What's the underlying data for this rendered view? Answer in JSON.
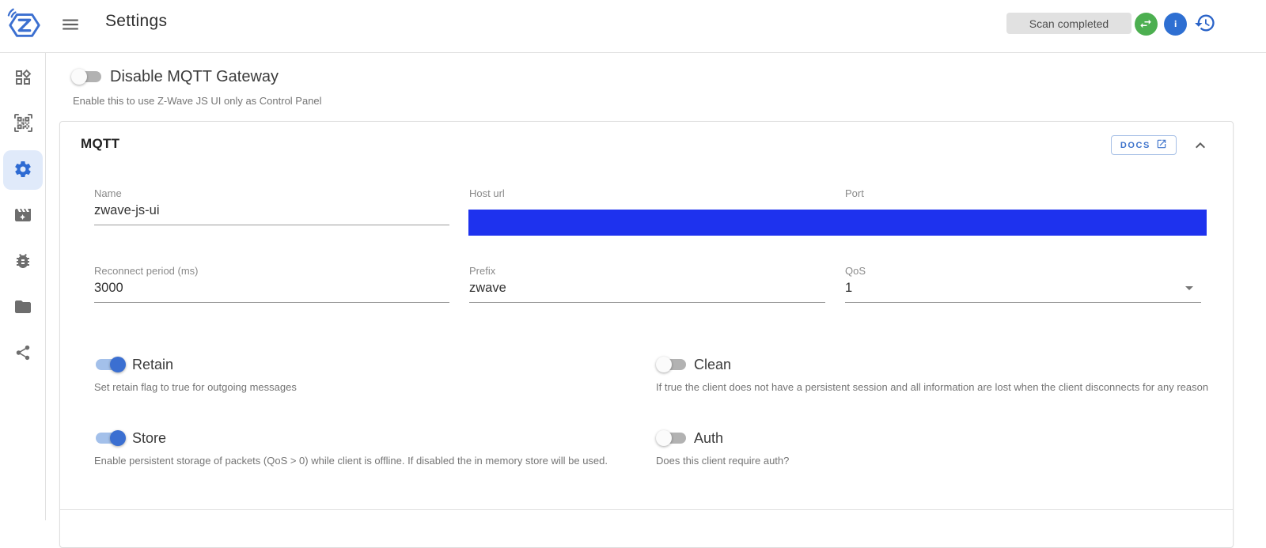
{
  "topbar": {
    "title": "Settings",
    "scan_chip": "Scan completed",
    "icons": [
      "menu-icon",
      "swap-horizontal-icon",
      "info-icon",
      "history-icon"
    ]
  },
  "sidebar": {
    "active_item": "settings",
    "items": [
      {
        "icon": "widgets-icon",
        "name": "control-panel"
      },
      {
        "icon": "qrcode-scan-icon",
        "name": "smart-start"
      },
      {
        "icon": "gear-icon",
        "name": "settings"
      },
      {
        "icon": "movie-filter-icon",
        "name": "scenes"
      },
      {
        "icon": "bug-icon",
        "name": "debug"
      },
      {
        "icon": "folder-icon",
        "name": "store"
      },
      {
        "icon": "share-icon",
        "name": "network-graph"
      }
    ]
  },
  "gateway_toggle": {
    "label": "Disable MQTT Gateway",
    "hint": "Enable this to use Z-Wave JS UI only as Control Panel",
    "on": false
  },
  "mqtt": {
    "title": "MQTT",
    "docs_button": "DOCS",
    "fields": {
      "name": {
        "label": "Name",
        "value": "zwave-js-ui"
      },
      "host_url": {
        "label": "Host url",
        "value": "",
        "redacted": true
      },
      "port": {
        "label": "Port",
        "value": "",
        "redacted": true
      },
      "reconnect_period": {
        "label": "Reconnect period (ms)",
        "value": "3000"
      },
      "prefix": {
        "label": "Prefix",
        "value": "zwave"
      },
      "qos": {
        "label": "QoS",
        "value": "1"
      }
    },
    "toggles": [
      {
        "label": "Retain",
        "hint": "Set retain flag to true for outgoing messages",
        "on": true
      },
      {
        "label": "Clean",
        "hint": "If true the client does not have a persistent session and all information are lost when the client disconnects for any reason",
        "on": false
      },
      {
        "label": "Store",
        "hint": "Enable persistent storage of packets (QoS > 0) while client is offline. If disabled the in memory store will be used.",
        "on": true
      },
      {
        "label": "Auth",
        "hint": "Does this client require auth?",
        "on": false
      }
    ]
  },
  "colors": {
    "primary_blue": "#2e6bd3",
    "toggle_on_blue": "#3b6fd1",
    "success_green": "#4caf50",
    "redaction_blue": "#1e32ee",
    "chip_gray": "#e1e1e1"
  }
}
